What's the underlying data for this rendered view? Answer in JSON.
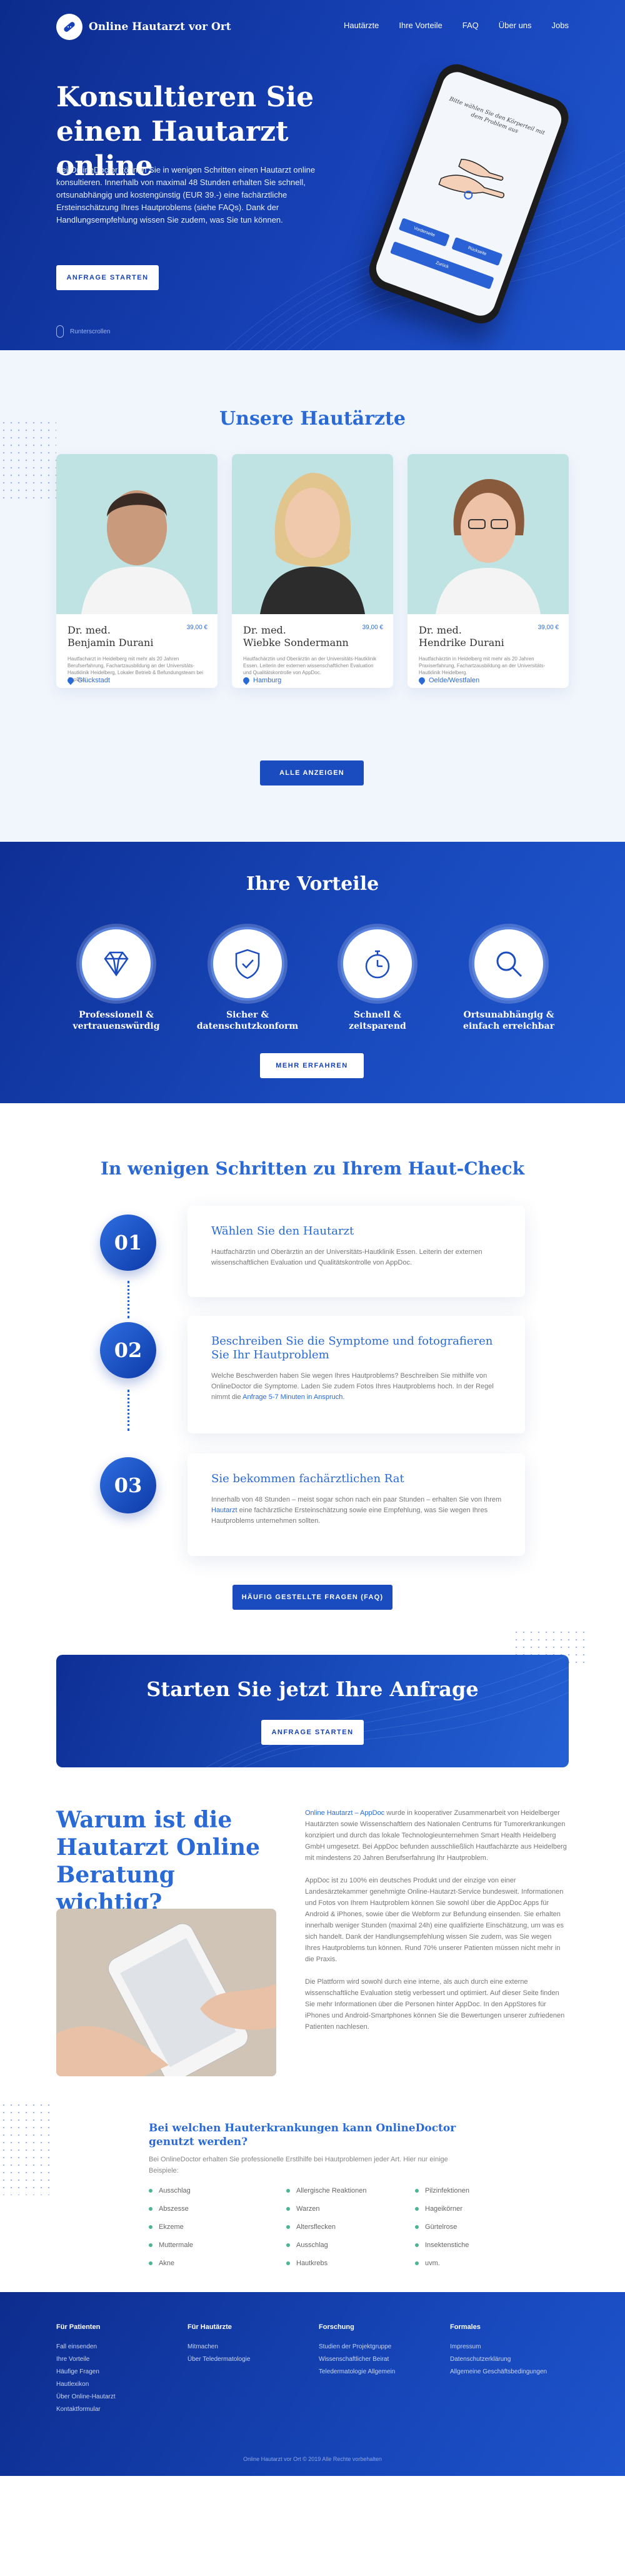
{
  "nav": {
    "logo_text": "Online Hautarzt vor Ort",
    "links": [
      "Hautärzte",
      "Ihre Vorteile",
      "FAQ",
      "Über uns",
      "Jobs"
    ]
  },
  "hero": {
    "title_line1": "Konsultieren Sie",
    "title_line2": "einen Hautarzt online",
    "text": "Bei OnlineDoctor können Sie in wenigen Schritten einen Hautarzt online konsultieren. Innerhalb von maximal 48 Stunden erhalten Sie schnell, ortsunabhängig und kostengünstig (EUR 39.-) eine fachärztliche Ersteinschätzung Ihres Hautproblems (siehe FAQs). Dank der Handlungsempfehlung wissen Sie zudem, was Sie tun können.",
    "cta": "ANFRAGE STARTEN",
    "scroll_label": "Runterscrollen",
    "phone_question": "Bitte wählen Sie den Körperteil mit dem Problem aus",
    "phone_buttons": [
      "Vorderseite",
      "Rückseite",
      "Zurück"
    ]
  },
  "doctors": {
    "title": "Unsere Hautärzte",
    "cards": [
      {
        "title": "Dr. med.",
        "name": "Benjamin Durani",
        "price": "39,00 €",
        "desc": "Hautfacharzt in Heidelberg mit mehr als 20 Jahren Berufserfahrung, Fachartzausbildung an der Universitäts-Hautklinik Heidelberg, Lokaler Betrieb & Befundungsteam bei AppDoc.",
        "location": "Glückstadt"
      },
      {
        "title": "Dr. med.",
        "name": "Wiebke Sondermann",
        "price": "39,00 €",
        "desc": "Hautfachärztin und Oberärztin an der Universitäts-Hautklinik Essen. Leiterin der externen wissenschaftlichen Evaluation und Qualitätskontrolle von AppDoc.",
        "location": "Hamburg"
      },
      {
        "title": "Dr. med.",
        "name": "Hendrike Durani",
        "price": "39,00 €",
        "desc": "Hautfachärztin in Heidelberg mit mehr als 20 Jahren Praxiserfahrung, Fachartzausbildung an der Universitäts-Hautklinik Heidelberg.",
        "location": "Oelde/Westfalen"
      }
    ],
    "button": "ALLE ANZEIGEN"
  },
  "vorteile": {
    "title": "Ihre Vorteile",
    "items": [
      {
        "line1": "Professionell &",
        "line2": "vertrauenswürdig",
        "icon": "diamond-icon"
      },
      {
        "line1": "Sicher &",
        "line2": "datenschutzkonform",
        "icon": "shield-check-icon"
      },
      {
        "line1": "Schnell &",
        "line2": "zeitsparend",
        "icon": "stopwatch-icon"
      },
      {
        "line1": "Ortsunabhängig &",
        "line2": "einfach erreichbar",
        "icon": "magnifier-icon"
      }
    ],
    "button": "MEHR ERFAHREN"
  },
  "steps": {
    "title": "In wenigen Schritten zu Ihrem Haut-Check",
    "items": [
      {
        "num": "01",
        "title": "Wählen Sie den Hautarzt",
        "text": "Hautfachärztin und Oberärztin an der Universitäts-Hautklinik Essen. Leiterin der externen wissenschaftlichen Evaluation und Qualitätskontrolle von AppDoc."
      },
      {
        "num": "02",
        "title": "Beschreiben Sie die Symptome und fotografieren Sie Ihr Hautproblem",
        "text": "Welche Beschwerden haben Sie wegen Ihres Hautproblems? Beschreiben Sie mithilfe von OnlineDoctor die Symptome. Laden Sie zudem Fotos Ihres Hautproblems hoch. In der Regel nimmt die",
        "highlight": "Anfrage 5-7 Minuten in Anspruch."
      },
      {
        "num": "03",
        "title": "Sie bekommen fachärztlichen Rat",
        "text_pre": "Innerhalb von 48 Stunden – meist sogar schon nach ein paar Stunden – erhalten Sie von Ihrem",
        "highlight": "Hautarzt",
        "text_post": "eine fachärztliche Ersteinschätzung sowie eine Empfehlung, was Sie wegen Ihres Hautproblems unternehmen sollten."
      }
    ],
    "button": "HÄUFIG GESTELLTE FRAGEN (FAQ)",
    "banner_title": "Starten Sie jetzt Ihre Anfrage",
    "banner_button": "ANFRAGE STARTEN"
  },
  "warum": {
    "title": "Warum ist die Hautarzt Online Beratung wichtig?",
    "p1_link": "Online Hautarzt – AppDoc",
    "p1": "wurde in kooperativer Zusammenarbeit von Heidelberger Hautärzten sowie Wissenschaftlern des Nationalen Centrums für Tumorerkrankungen konzipiert und durch das lokale Technologieunternehmen Smart Health Heidelberg GmbH umgesetzt. Bei AppDoc befunden ausschließlich Hautfachärzte aus Heidelberg mit mindestens 20 Jahren Berufserfahrung Ihr Hautproblem.",
    "p2": "AppDoc ist zu 100% ein deutsches Produkt und der einzige von einer Landesärztekammer genehmigte Online-Hautarzt-Service bundesweit. Informationen und Fotos von Ihrem Hautproblem können Sie sowohl über die AppDoc Apps für Android & iPhones, sowie über die Webform zur Befundung einsenden. Sie erhalten innerhalb weniger Stunden (maximal 24h) eine qualifizierte Einschätzung, um was es sich handelt. Dank der Handlungsempfehlung wissen Sie zudem, was Sie wegen Ihres Hautproblems tun können. Rund 70% unserer Patienten müssen nicht mehr in die Praxis.",
    "p3": "Die Plattform wird sowohl durch eine interne, als auch durch eine externe wissenschaftliche Evaluation stetig verbessert und optimiert. Auf dieser Seite finden Sie mehr Informationen über die Personen hinter AppDoc. In den AppStores für iPhones und Android-Smartphones können Sie die Bewertungen unserer zufriedenen Patienten nachlesen.",
    "list_title": "Bei welchen Hauterkrankungen kann OnlineDoctor genutzt werden?",
    "list_text": "Bei OnlineDoctor erhalten Sie professionelle Erstlhilfe bei Hautproblemen jeder Art. Hier nur einige Beispiele:",
    "col1": [
      "Ausschlag",
      "Abszesse",
      "Ekzeme",
      "Muttermale",
      "Akne"
    ],
    "col2": [
      "Allergische Reaktionen",
      "Warzen",
      "Altersflecken",
      "Ausschlag",
      "Hautkrebs"
    ],
    "col3": [
      "Pilzinfektionen",
      "Hageikörner",
      "Gürtelrose",
      "Insektenstiche",
      "uvm."
    ]
  },
  "footer": {
    "cols": [
      {
        "title": "Für Patienten",
        "links": [
          "Fall einsenden",
          "Ihre Vorteile",
          "Häufige Fragen",
          "Hautlexikon",
          "Über Online-Hautarzt",
          "Kontaktformular"
        ]
      },
      {
        "title": "Für Hautärzte",
        "links": [
          "Mitmachen",
          "Über Teledermatologie"
        ]
      },
      {
        "title": "Forschung",
        "links": [
          "Studien der Projektgruppe",
          "Wissenschaftlicher Beirat",
          "Teledermatologie Allgemein"
        ]
      },
      {
        "title": "Formales",
        "links": [
          "Impressum",
          "Datenschutzerklärung",
          "Allgemeine Geschäftsbedingungen"
        ]
      }
    ],
    "copyright": "Online Hautarzt vor Ort © 2019 Alle Rechte vorbehalten"
  },
  "colors": {
    "primary": "#1742b8",
    "accent": "#2a6ad6",
    "bullet": "#4ab58f"
  }
}
